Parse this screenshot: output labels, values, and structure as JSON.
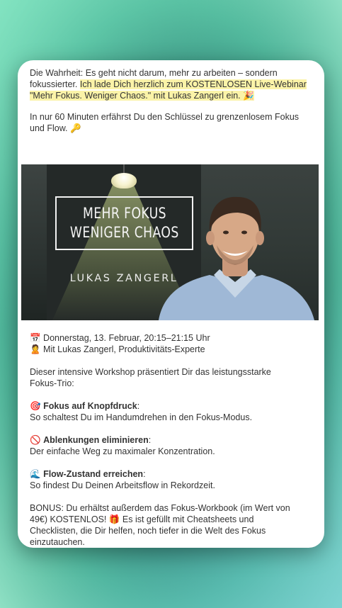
{
  "intro": {
    "plain": "Die Wahrheit: Es geht nicht darum, mehr zu arbeiten – sondern fokussierter. ",
    "highlight": "Ich lade Dich herzlich zum KOSTENLOSEN Live-Webinar \"Mehr Fokus. Weniger Chaos.\" mit Lukas Zangerl ein. 🎉"
  },
  "promise": "In nur 60 Minuten erfährst Du den Schlüssel zu grenzenlosem Fokus und Flow. 🔑",
  "hero": {
    "title_line1": "MEHR FOKUS",
    "title_line2": "WENIGER CHAOS",
    "author": "LUKAS ZANGERL"
  },
  "event": {
    "date": "📅 Donnerstag, 13. Februar, 20:15–21:15 Uhr",
    "host": "🙎 Mit Lukas Zangerl, Produktivitäts-Experte"
  },
  "workshop_intro_line1": "Dieser intensive Workshop präsentiert Dir das leistungsstarke",
  "workshop_intro_line2": "Fokus-Trio:",
  "benefits": [
    {
      "icon": "🎯",
      "title": "Fokus auf Knopfdruck",
      "suffix": ":",
      "text": "So schaltest Du im Handumdrehen in den Fokus-Modus."
    },
    {
      "icon": "🚫",
      "title": "Ablenkungen eliminieren",
      "suffix": ":",
      "text": "Der einfache Weg zu maximaler Konzentration."
    },
    {
      "icon": "🌊",
      "title": "Flow-Zustand erreichen",
      "suffix": ":",
      "text": "So findest Du Deinen Arbeitsflow in Rekordzeit."
    }
  ],
  "bonus": {
    "line1": "BONUS: Du erhältst außerdem das Fokus-Workbook (im Wert von",
    "line2": "49€) KOSTENLOS! 🎁 Es ist gefüllt mit Cheatsheets und",
    "line3": "Checklisten, die Dir helfen, noch tiefer in die Welt des Fokus",
    "line4": "einzutauchen."
  }
}
